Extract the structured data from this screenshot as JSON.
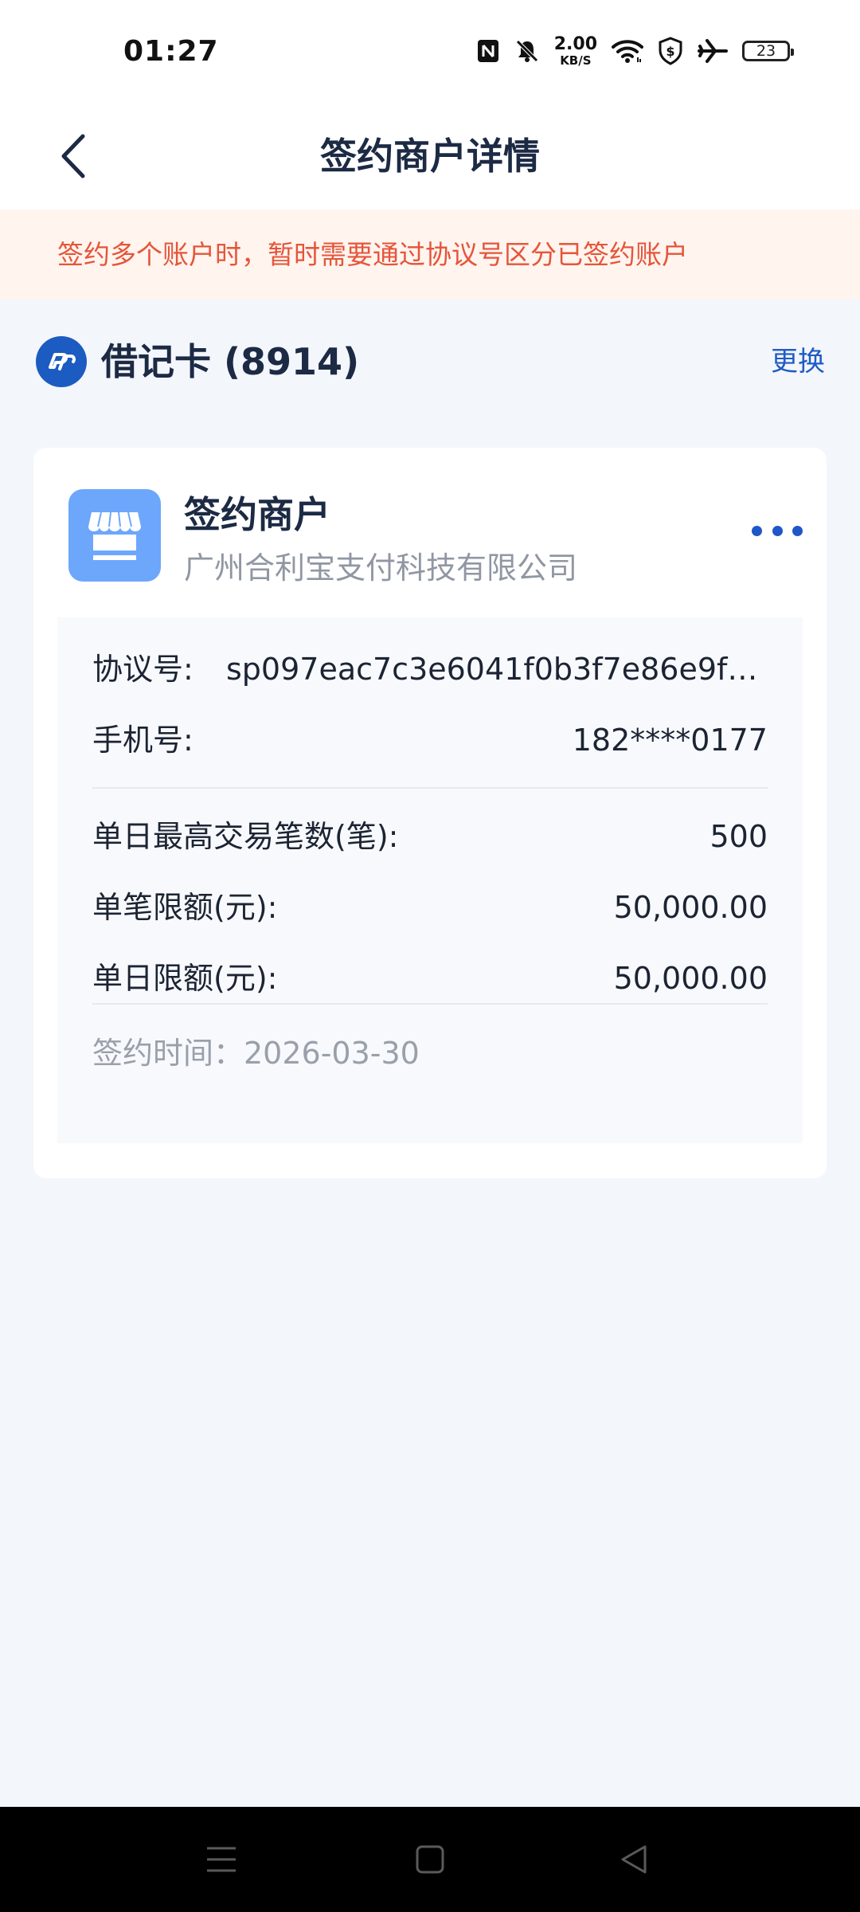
{
  "status_bar": {
    "time": "01:27",
    "net_speed_value": "2.00",
    "net_speed_unit": "KB/S",
    "battery_level": "23",
    "icons": [
      "nfc-icon",
      "mute-icon",
      "wifi-icon",
      "shield-icon",
      "airplane-icon",
      "battery-icon"
    ]
  },
  "header": {
    "title": "签约商户详情",
    "back_icon": "chevron-left-icon"
  },
  "notice": {
    "text": "签约多个账户时，暂时需要通过协议号区分已签约账户"
  },
  "card": {
    "name": "借记卡 (8914)",
    "change_label": "更换",
    "logo_icon": "bank-logo-icon",
    "logo_color": "#1c5bc1"
  },
  "merchant": {
    "title": "签约商户",
    "company": "广州合利宝支付科技有限公司",
    "icon": "store-icon",
    "more_icon": "more-dots-icon",
    "details": {
      "agreement_label": "协议号:",
      "agreement_value": "sp097eac7c3e6041f0b3f7e86e9f79...",
      "phone_label": "手机号:",
      "phone_value": "182****0177",
      "daily_count_label": "单日最高交易笔数(笔):",
      "daily_count_value": "500",
      "single_limit_label": "单笔限额(元):",
      "single_limit_value": "50,000.00",
      "daily_limit_label": "单日限额(元):",
      "daily_limit_value": "50,000.00",
      "signed_time": "签约时间：2026-03-30"
    }
  },
  "colors": {
    "accent": "#1f5bc4",
    "notice_text": "#e5553a",
    "notice_bg": "#fff4ee",
    "page_bg": "#f3f6fb",
    "store_icon_bg": "#6da7fb"
  },
  "system_nav": {
    "icons": [
      "menu-icon",
      "home-icon",
      "back-triangle-icon"
    ]
  }
}
